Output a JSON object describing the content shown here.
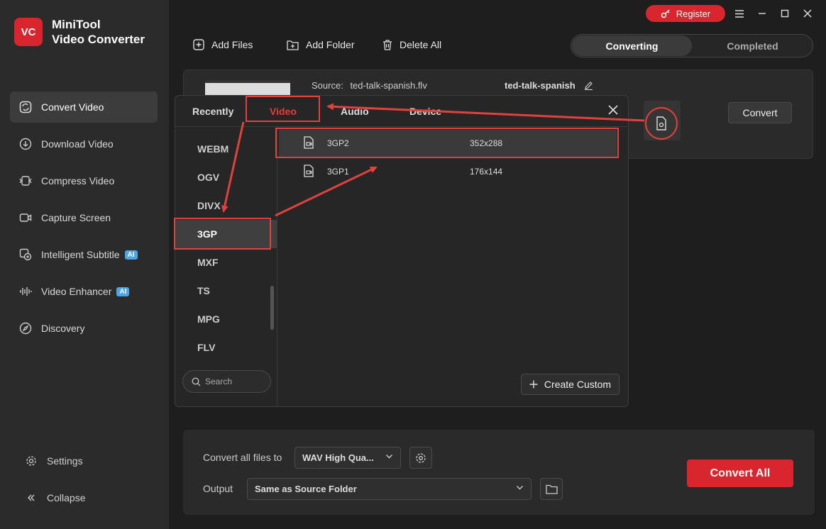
{
  "app": {
    "name_line1": "MiniTool",
    "name_line2": "Video Converter",
    "logo_text": "VC"
  },
  "titlebar": {
    "register_label": "Register"
  },
  "sidebar": {
    "items": [
      {
        "label": "Convert Video"
      },
      {
        "label": "Download Video"
      },
      {
        "label": "Compress Video"
      },
      {
        "label": "Capture Screen"
      },
      {
        "label": "Intelligent Subtitle",
        "badge": "AI"
      },
      {
        "label": "Video Enhancer",
        "badge": "AI"
      },
      {
        "label": "Discovery"
      }
    ],
    "settings_label": "Settings",
    "collapse_label": "Collapse"
  },
  "toolbar": {
    "add_files": "Add Files",
    "add_folder": "Add Folder",
    "delete_all": "Delete All"
  },
  "tabs": {
    "converting": "Converting",
    "completed": "Completed"
  },
  "file": {
    "source_label": "Source:",
    "source_name": "ted-talk-spanish.flv",
    "target_name": "ted-talk-spanish",
    "convert_label": "Convert"
  },
  "popup": {
    "tabs": [
      "Recently",
      "Video",
      "Audio",
      "Device"
    ],
    "formats": [
      "WEBM",
      "OGV",
      "DIVX",
      "3GP",
      "MXF",
      "TS",
      "MPG",
      "FLV"
    ],
    "selected_format": "3GP",
    "presets": [
      {
        "name": "3GP2",
        "resolution": "352x288"
      },
      {
        "name": "3GP1",
        "resolution": "176x144"
      }
    ],
    "search_placeholder": "Search",
    "create_custom": "Create Custom"
  },
  "bottom": {
    "convert_all_to_label": "Convert all files to",
    "convert_all_to_value": "WAV High Qua...",
    "output_label": "Output",
    "output_value": "Same as Source Folder",
    "convert_all_button": "Convert All"
  },
  "colors": {
    "accent": "#d9262e",
    "highlight": "#e0413c"
  }
}
